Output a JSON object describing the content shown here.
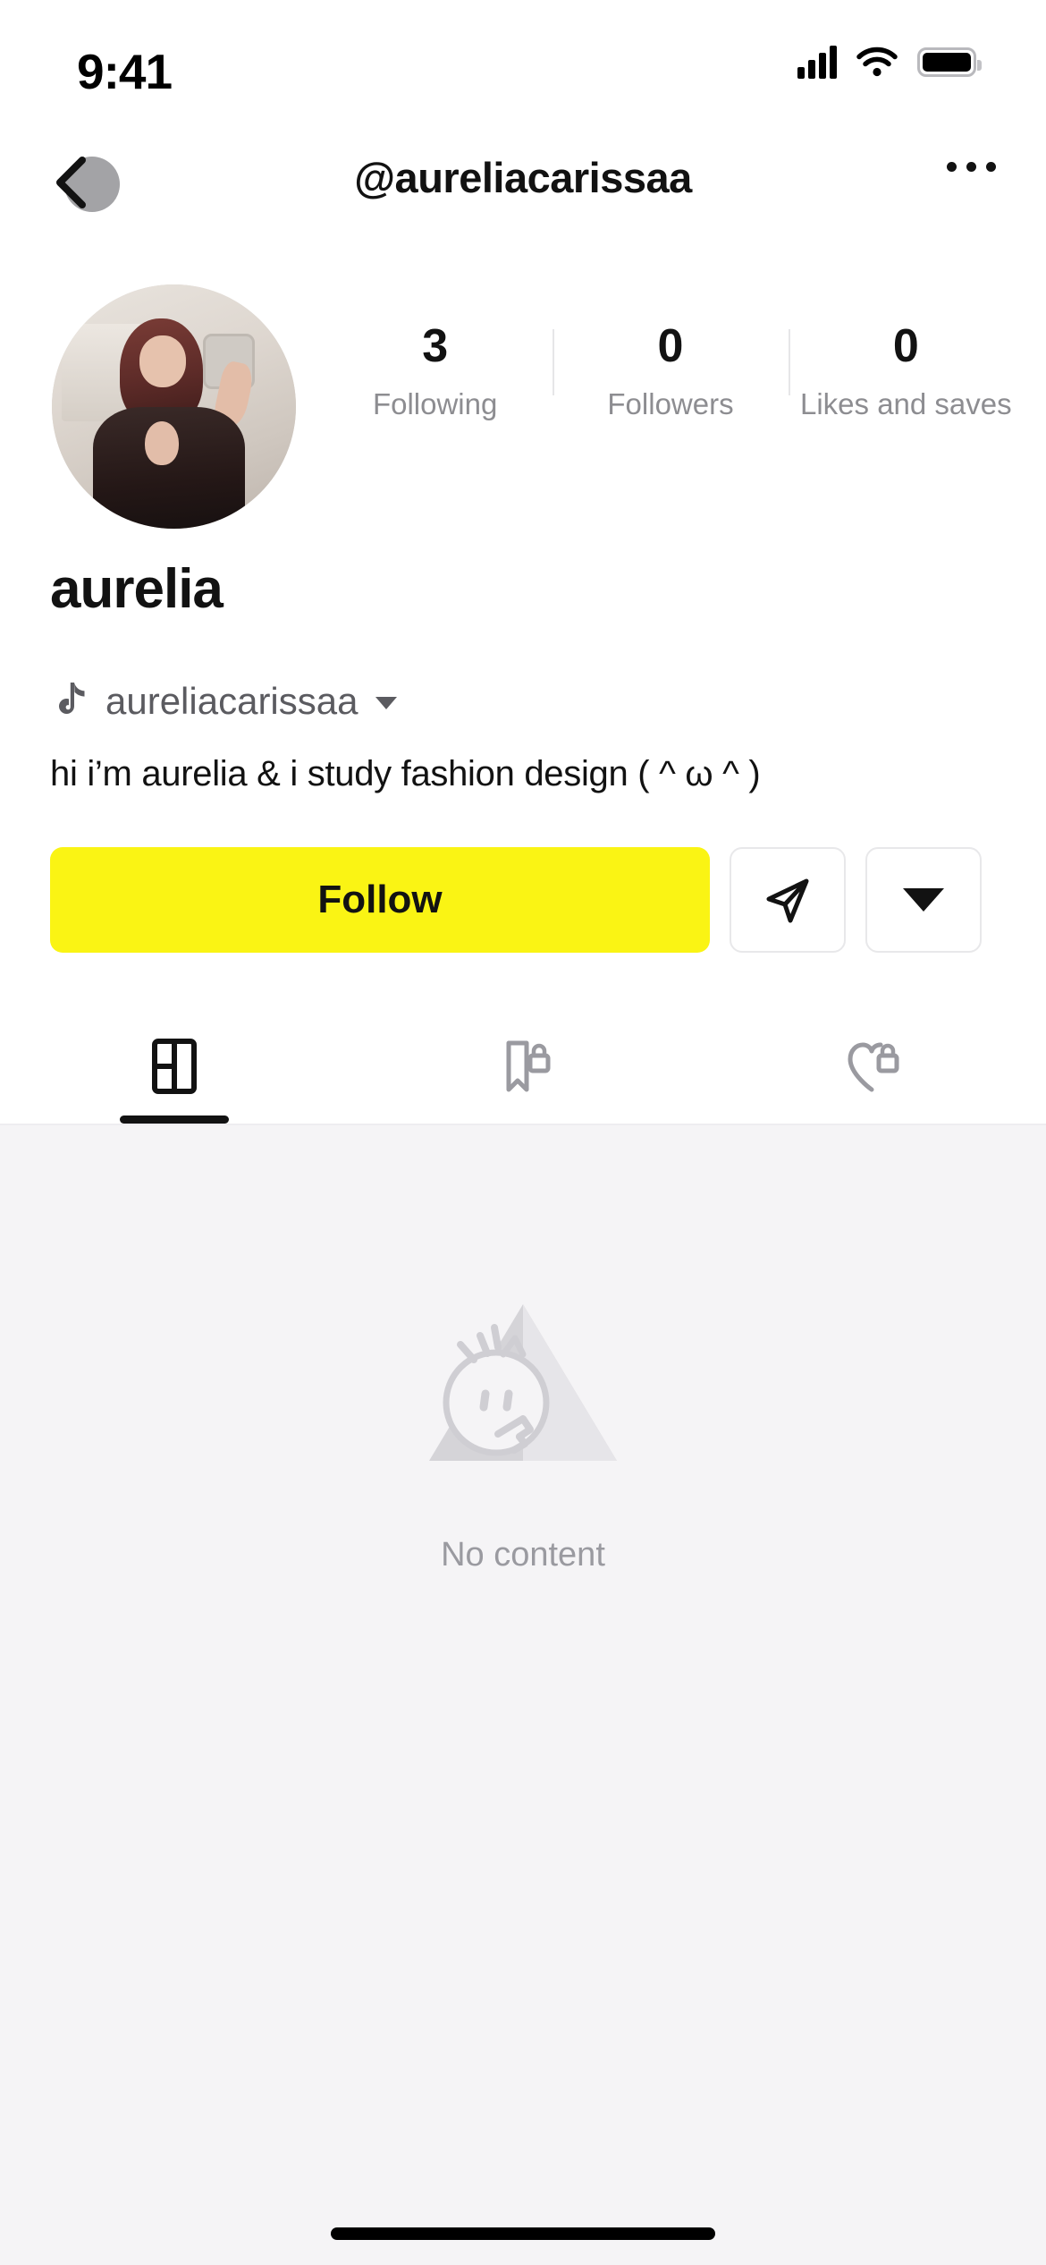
{
  "status_bar": {
    "time": "9:41",
    "cellular_icon": "signal-bars-icon",
    "wifi_icon": "wifi-icon",
    "battery_icon": "battery-icon"
  },
  "nav": {
    "back_icon": "back-chevron-icon",
    "title": "@aureliacarissaa",
    "more_icon": "more-options-icon"
  },
  "profile": {
    "avatar_alt": "profile-avatar",
    "display_name": "aurelia",
    "handle": "aureliacarissaa",
    "handle_icon": "tiktok-note-icon",
    "handle_caret_icon": "chevron-down-icon",
    "bio": "hi i’m aurelia & i study fashion design   ( ^ ω ^ )"
  },
  "stats": [
    {
      "value": "3",
      "label": "Following"
    },
    {
      "value": "0",
      "label": "Followers"
    },
    {
      "value": "0",
      "label": "Likes and saves"
    }
  ],
  "actions": {
    "follow_label": "Follow",
    "follow_color": "#faf414",
    "message_icon": "send-message-icon",
    "more_caret_icon": "chevron-down-icon"
  },
  "tabs": [
    {
      "name": "videos",
      "icon": "grid-layout-icon",
      "active": true
    },
    {
      "name": "saved",
      "icon": "bookmark-lock-icon",
      "active": false
    },
    {
      "name": "liked",
      "icon": "heart-lock-icon",
      "active": false
    }
  ],
  "content": {
    "empty_icon": "no-content-illustration",
    "empty_text": "No content"
  },
  "home_indicator": "home-indicator"
}
